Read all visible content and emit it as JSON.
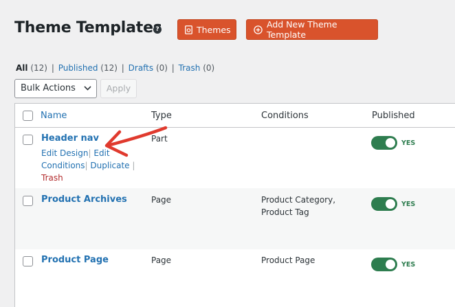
{
  "header": {
    "title": "Theme Templates",
    "help_icon": "?",
    "themes_button": "Themes",
    "add_button": "Add New Theme Template"
  },
  "filters": {
    "all_label": "All",
    "all_count": "(12)",
    "published_label": "Published",
    "published_count": "(12)",
    "drafts_label": "Drafts",
    "drafts_count": "(0)",
    "trash_label": "Trash",
    "trash_count": "(0)",
    "separator": "|"
  },
  "bulk": {
    "selected": "Bulk Actions",
    "apply": "Apply"
  },
  "table": {
    "columns": {
      "name": "Name",
      "type": "Type",
      "conditions": "Conditions",
      "published": "Published"
    },
    "rows": [
      {
        "name": "Header nav",
        "type": "Part",
        "conditions": "",
        "published": "YES",
        "actions": {
          "edit_design": "Edit Design",
          "edit_conditions_1": "Edit",
          "edit_conditions_2": "Conditions",
          "duplicate": "Duplicate",
          "trash": "Trash",
          "sep": "|"
        }
      },
      {
        "name": "Product Archives",
        "type": "Page",
        "conditions_line1": "Product Category,",
        "conditions_line2": "Product Tag",
        "published": "YES"
      },
      {
        "name": "Product Page",
        "type": "Page",
        "conditions": "Product Page",
        "published": "YES"
      }
    ]
  },
  "colors": {
    "accent_orange": "#d9532c",
    "link_blue": "#2271b1",
    "toggle_green": "#2e7d4f",
    "trash_red": "#b32d2e",
    "annotation_red": "#e03a2e"
  },
  "icons": {
    "themes": "template-icon",
    "add": "plus-circle-icon",
    "help": "question-circle-icon",
    "annotation": "red-arrow-annotation"
  }
}
